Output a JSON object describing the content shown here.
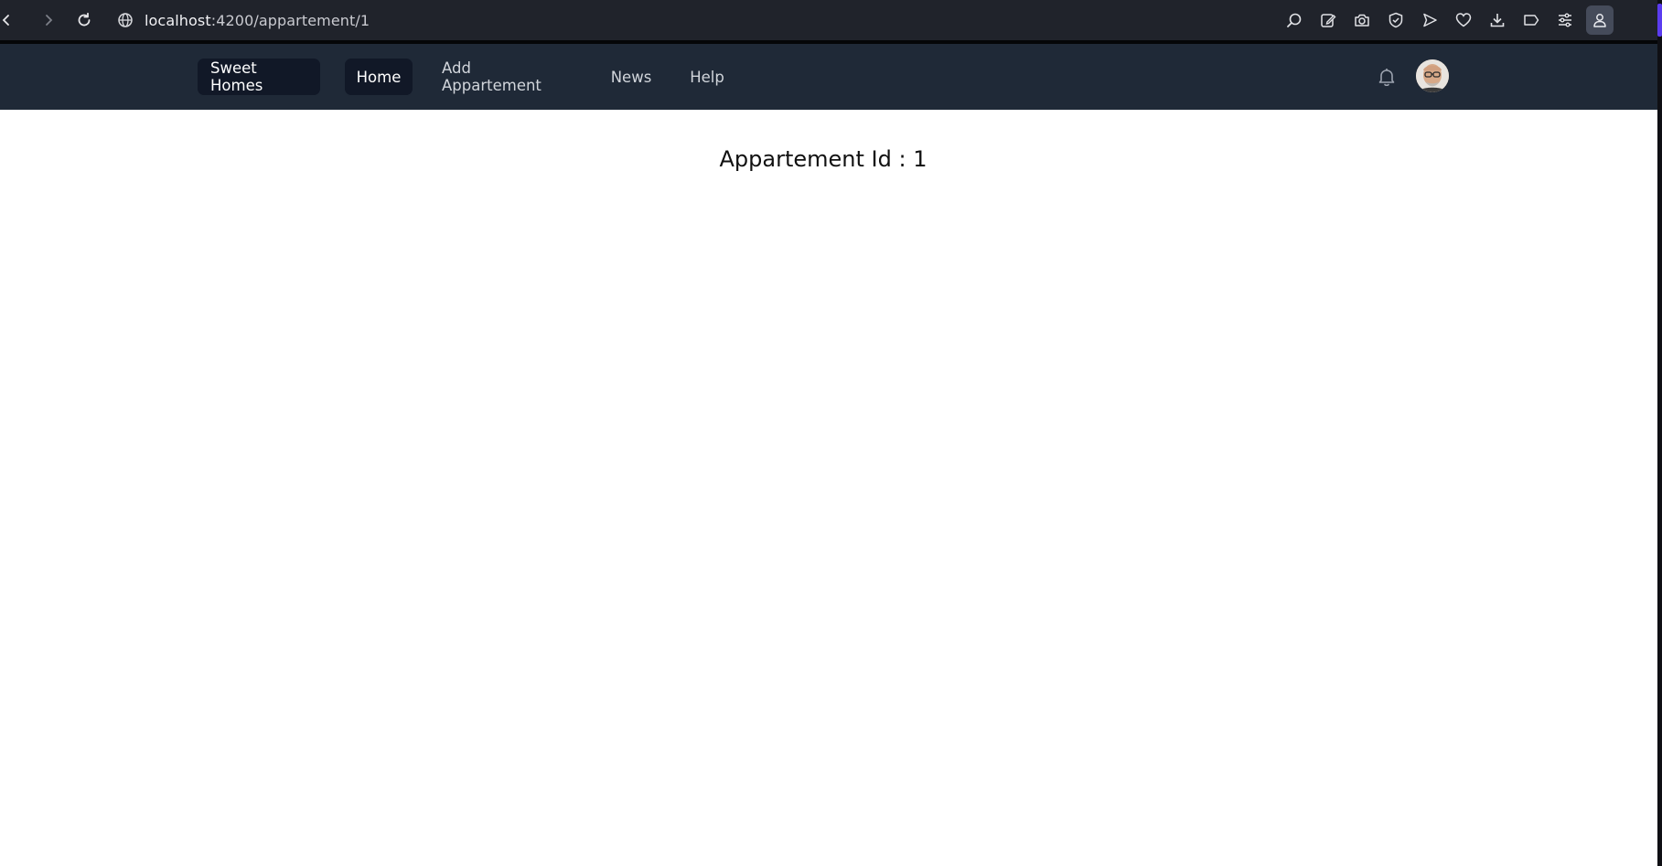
{
  "browser": {
    "url_host": "localhost",
    "url_path": ":4200/appartement/1",
    "icons": [
      "back-icon",
      "forward-icon",
      "reload-icon",
      "globe-icon",
      "search-icon",
      "edit-icon",
      "camera-icon",
      "shield-icon",
      "send-icon",
      "heart-icon",
      "download-icon",
      "tag-icon",
      "settings-icon",
      "profile-icon"
    ]
  },
  "nav": {
    "brand": "Sweet Homes",
    "items": [
      {
        "label": "Home",
        "active": true
      },
      {
        "label": "Add Appartement",
        "active": false
      },
      {
        "label": "News",
        "active": false
      },
      {
        "label": "Help",
        "active": false
      }
    ]
  },
  "main": {
    "heading": "Appartement Id : 1"
  },
  "colors": {
    "browser_bar": "#20232b",
    "navbar": "#1f2937",
    "nav_active": "#111827",
    "accent": "#5b3cf0"
  }
}
